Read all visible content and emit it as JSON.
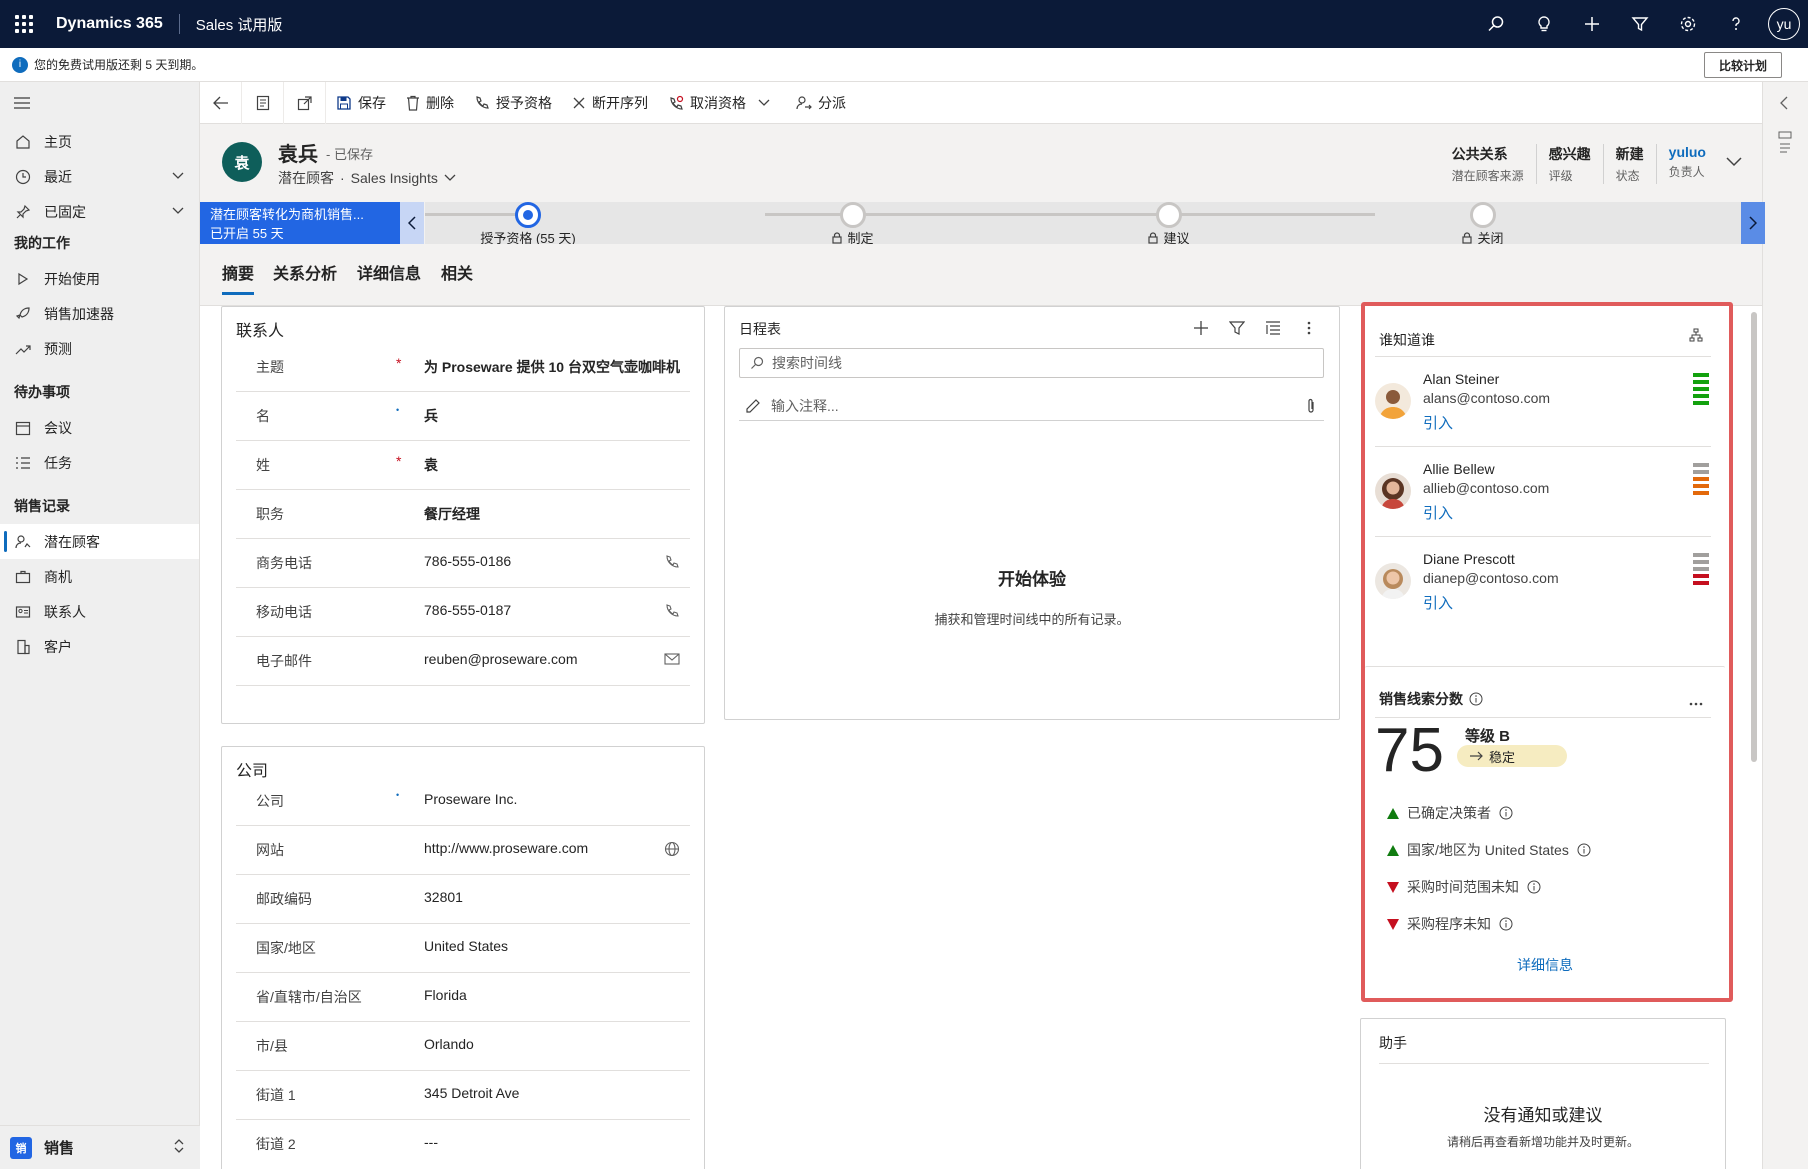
{
  "topbar": {
    "brand": "Dynamics 365",
    "app": "Sales 试用版",
    "user_initials": "yu",
    "icons": [
      "search-icon",
      "lightbulb-icon",
      "plus-icon",
      "filter-icon",
      "gear-icon",
      "help-icon"
    ]
  },
  "notification": {
    "text": "您的免费试用版还剩 5 天到期。",
    "button": "比较计划"
  },
  "sidebar": {
    "items": [
      {
        "label": "主页",
        "icon": "home-icon"
      },
      {
        "label": "最近",
        "icon": "clock-icon"
      },
      {
        "label": "已固定",
        "icon": "pin-icon"
      }
    ],
    "groups": [
      {
        "title": "我的工作",
        "items": [
          {
            "label": "开始使用",
            "icon": "play-icon"
          },
          {
            "label": "销售加速器",
            "icon": "rocket-icon"
          },
          {
            "label": "预测",
            "icon": "trend-icon"
          }
        ]
      },
      {
        "title": "待办事项",
        "items": [
          {
            "label": "会议",
            "icon": "calendar-icon"
          },
          {
            "label": "任务",
            "icon": "tasks-icon"
          }
        ]
      },
      {
        "title": "销售记录",
        "items": [
          {
            "label": "潜在顾客",
            "icon": "lead-icon"
          },
          {
            "label": "商机",
            "icon": "briefcase-icon"
          },
          {
            "label": "联系人",
            "icon": "contact-card-icon"
          },
          {
            "label": "客户",
            "icon": "building-icon"
          }
        ]
      }
    ],
    "area": {
      "badge": "销",
      "label": "销售"
    }
  },
  "commands": {
    "save": "保存",
    "delete": "删除",
    "qualify": "授予资格",
    "disconnect": "断开序列",
    "disqualify": "取消资格",
    "assign": "分派"
  },
  "record": {
    "avatar": "袁",
    "name": "袁兵",
    "saved": "- 已保存",
    "entity": "潜在顾客",
    "dot": "·",
    "view": "Sales Insights",
    "header_fields": [
      {
        "value": "公共关系",
        "label": "潜在顾客来源"
      },
      {
        "value": "感兴趣",
        "label": "评级"
      },
      {
        "value": "新建",
        "label": "状态"
      },
      {
        "value": "yuluo",
        "label": "负责人"
      }
    ]
  },
  "bpf": {
    "active_title": "潜在顾客转化为商机销售...",
    "active_sub": "已开启 55 天",
    "stages": [
      {
        "label": "授予资格 (55 天)",
        "active": true
      },
      {
        "label": "制定",
        "active": false
      },
      {
        "label": "建议",
        "active": false
      },
      {
        "label": "关闭",
        "active": false
      }
    ]
  },
  "tabs": [
    "摘要",
    "关系分析",
    "详细信息",
    "相关"
  ],
  "contact_section": {
    "title": "联系人",
    "fields": [
      {
        "label": "主题",
        "req": "*",
        "value": "为 Proseware 提供 10 台双空气壶咖啡机",
        "bold": true
      },
      {
        "label": "名",
        "req": "•",
        "value": "兵",
        "bold": true
      },
      {
        "label": "姓",
        "req": "*",
        "value": "袁",
        "bold": true
      },
      {
        "label": "职务",
        "req": "",
        "value": "餐厅经理",
        "bold": true
      },
      {
        "label": "商务电话",
        "req": "",
        "value": "786-555-0186",
        "bold": false
      },
      {
        "label": "移动电话",
        "req": "",
        "value": "786-555-0187",
        "bold": false
      },
      {
        "label": "电子邮件",
        "req": "",
        "value": "reuben@proseware.com",
        "bold": false
      }
    ]
  },
  "company_section": {
    "title": "公司",
    "fields": [
      {
        "label": "公司",
        "req": "•",
        "value": "Proseware Inc."
      },
      {
        "label": "网站",
        "req": "",
        "value": "http://www.proseware.com"
      },
      {
        "label": "邮政编码",
        "req": "",
        "value": "32801"
      },
      {
        "label": "国家/地区",
        "req": "",
        "value": "United States"
      },
      {
        "label": "省/直辖市/自治区",
        "req": "",
        "value": "Florida"
      },
      {
        "label": "市/县",
        "req": "",
        "value": "Orlando"
      },
      {
        "label": "街道 1",
        "req": "",
        "value": "345 Detroit Ave"
      },
      {
        "label": "街道 2",
        "req": "",
        "value": "---"
      }
    ]
  },
  "timeline": {
    "title": "日程表",
    "search_placeholder": "搜索时间线",
    "note_placeholder": "输入注释...",
    "empty_title": "开始体验",
    "empty_sub": "捕获和管理时间线中的所有记录。"
  },
  "who_knows_whom": {
    "title": "谁知道谁",
    "people": [
      {
        "name": "Alan Steiner",
        "email": "alans@contoso.com",
        "action": "引入",
        "strength": "strong"
      },
      {
        "name": "Allie Bellew",
        "email": "allieb@contoso.com",
        "action": "引入",
        "strength": "medium"
      },
      {
        "name": "Diane Prescott",
        "email": "dianep@contoso.com",
        "action": "引入",
        "strength": "weak"
      }
    ]
  },
  "lead_score": {
    "title": "销售线索分数",
    "score": "75",
    "grade": "等级 B",
    "trend": "稳定",
    "factors": [
      {
        "text": "已确定决策者",
        "direction": "up"
      },
      {
        "text": "国家/地区为 United States",
        "direction": "up"
      },
      {
        "text": "采购时间范围未知",
        "direction": "down"
      },
      {
        "text": "采购程序未知",
        "direction": "down"
      }
    ],
    "more": "详细信息",
    "colors": {
      "up": "#107c10",
      "down": "#c50f1f"
    }
  },
  "assistant": {
    "title": "助手",
    "empty": "没有通知或建议",
    "sub": "请稍后再查看新增功能并及时更新。"
  }
}
